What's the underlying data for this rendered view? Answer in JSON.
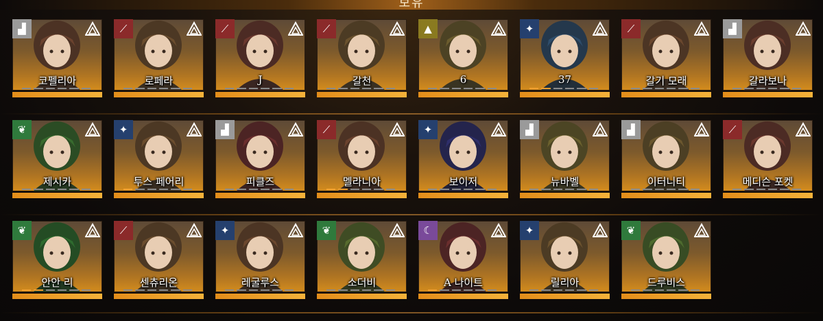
{
  "header": {
    "title": "보유"
  },
  "characters": [
    {
      "name": "코펠리아",
      "attribute": "strength-icon",
      "progress": 0
    },
    {
      "name": "로페라",
      "attribute": "instinct-icon",
      "progress": 0
    },
    {
      "name": "J",
      "attribute": "instinct-icon",
      "progress": 0
    },
    {
      "name": "갈천",
      "attribute": "instinct-icon",
      "progress": 0
    },
    {
      "name": "6",
      "attribute": "star-icon",
      "progress": 0
    },
    {
      "name": "37",
      "attribute": "intellect-icon",
      "progress": 2
    },
    {
      "name": "갈기 모래",
      "attribute": "instinct-icon",
      "progress": 0
    },
    {
      "name": "갈라보나",
      "attribute": "strength-icon",
      "progress": 0
    },
    {
      "name": "제시카",
      "attribute": "spirit-icon",
      "progress": 0
    },
    {
      "name": "투스 페어리",
      "attribute": "intellect-icon",
      "progress": 1
    },
    {
      "name": "피클즈",
      "attribute": "strength-icon",
      "progress": 0
    },
    {
      "name": "멜라니아",
      "attribute": "instinct-icon",
      "progress": 2
    },
    {
      "name": "보이저",
      "attribute": "intellect-icon",
      "progress": 0
    },
    {
      "name": "뉴바벨",
      "attribute": "strength-icon",
      "progress": 0
    },
    {
      "name": "이터니티",
      "attribute": "strength-icon",
      "progress": 0
    },
    {
      "name": "메디슨 포켓",
      "attribute": "instinct-icon",
      "progress": 0
    },
    {
      "name": "안안 리",
      "attribute": "spirit-icon",
      "progress": 2
    },
    {
      "name": "센츄리온",
      "attribute": "instinct-icon",
      "progress": 0
    },
    {
      "name": "레굴루스",
      "attribute": "intellect-icon",
      "progress": 0
    },
    {
      "name": "소더비",
      "attribute": "spirit-icon",
      "progress": 0
    },
    {
      "name": "A 나이트",
      "attribute": "mind-icon",
      "progress": 1
    },
    {
      "name": "릴리아",
      "attribute": "intellect-icon",
      "progress": 0
    },
    {
      "name": "드루비스",
      "attribute": "spirit-icon",
      "progress": 0
    }
  ],
  "colors": {
    "accent": "#f0a030",
    "strength": "#9a9a9a",
    "instinct": "#8b2a2a",
    "intellect": "#25406e",
    "spirit": "#2f7a3c",
    "mind": "#7a4a9a"
  }
}
